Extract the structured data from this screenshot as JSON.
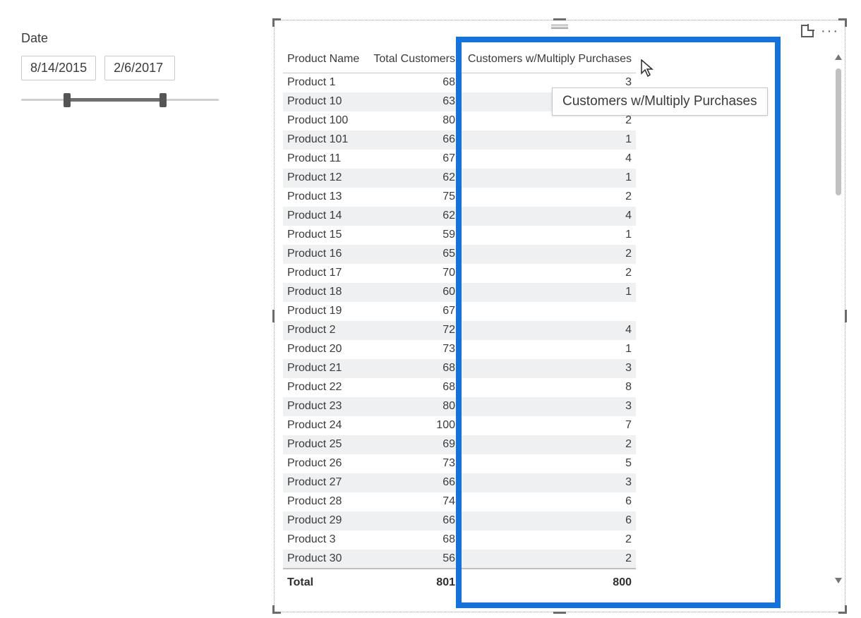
{
  "slicer": {
    "title": "Date",
    "from": "8/14/2015",
    "to": "2/6/2017"
  },
  "table": {
    "columns": {
      "name": "Product Name",
      "total_customers": "Total Customers",
      "multi_purchases": "Customers w/Multiply Purchases"
    },
    "rows": [
      {
        "name": "Product 1",
        "tc": "68",
        "mp": "3"
      },
      {
        "name": "Product 10",
        "tc": "63",
        "mp": ""
      },
      {
        "name": "Product 100",
        "tc": "80",
        "mp": "2"
      },
      {
        "name": "Product 101",
        "tc": "66",
        "mp": "1"
      },
      {
        "name": "Product 11",
        "tc": "67",
        "mp": "4"
      },
      {
        "name": "Product 12",
        "tc": "62",
        "mp": "1"
      },
      {
        "name": "Product 13",
        "tc": "75",
        "mp": "2"
      },
      {
        "name": "Product 14",
        "tc": "62",
        "mp": "4"
      },
      {
        "name": "Product 15",
        "tc": "59",
        "mp": "1"
      },
      {
        "name": "Product 16",
        "tc": "65",
        "mp": "2"
      },
      {
        "name": "Product 17",
        "tc": "70",
        "mp": "2"
      },
      {
        "name": "Product 18",
        "tc": "60",
        "mp": "1"
      },
      {
        "name": "Product 19",
        "tc": "67",
        "mp": ""
      },
      {
        "name": "Product 2",
        "tc": "72",
        "mp": "4"
      },
      {
        "name": "Product 20",
        "tc": "73",
        "mp": "1"
      },
      {
        "name": "Product 21",
        "tc": "68",
        "mp": "3"
      },
      {
        "name": "Product 22",
        "tc": "68",
        "mp": "8"
      },
      {
        "name": "Product 23",
        "tc": "80",
        "mp": "3"
      },
      {
        "name": "Product 24",
        "tc": "100",
        "mp": "7"
      },
      {
        "name": "Product 25",
        "tc": "69",
        "mp": "2"
      },
      {
        "name": "Product 26",
        "tc": "73",
        "mp": "5"
      },
      {
        "name": "Product 27",
        "tc": "66",
        "mp": "3"
      },
      {
        "name": "Product 28",
        "tc": "74",
        "mp": "6"
      },
      {
        "name": "Product 29",
        "tc": "66",
        "mp": "6"
      },
      {
        "name": "Product 3",
        "tc": "68",
        "mp": "2"
      },
      {
        "name": "Product 30",
        "tc": "56",
        "mp": "2"
      }
    ],
    "totals": {
      "label": "Total",
      "tc": "801",
      "mp": "800"
    }
  },
  "tooltip": "Customers w/Multiply Purchases",
  "icons": {
    "more": "···"
  }
}
